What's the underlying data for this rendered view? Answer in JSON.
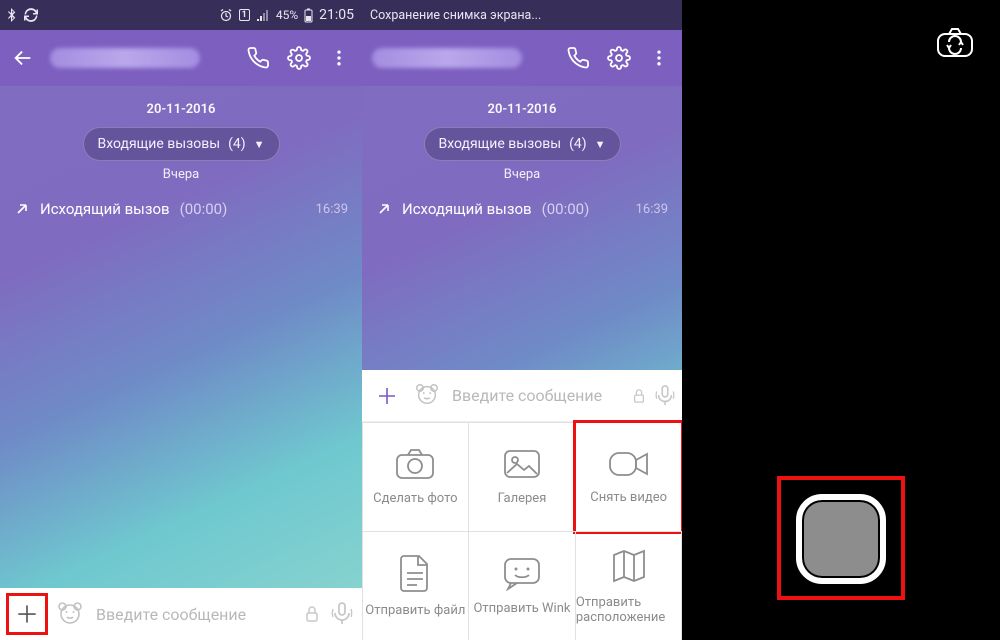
{
  "statusbar": {
    "battery": "45%",
    "time": "21:05",
    "screenshot_toast": "Сохранение снимка экрана..."
  },
  "chat": {
    "date": "20-11-2016",
    "incoming_label": "Входящие вызовы",
    "incoming_count": "(4)",
    "yesterday": "Вчера",
    "outgoing_label": "Исходящий вызов",
    "outgoing_duration": "(00:00)",
    "outgoing_time": "16:39"
  },
  "input": {
    "placeholder": "Введите сообщение"
  },
  "attach": {
    "photo": "Сделать фото",
    "gallery": "Галерея",
    "video": "Снять видео",
    "file": "Отправить файл",
    "wink": "Отправить Wink",
    "location": "Отправить расположение"
  }
}
